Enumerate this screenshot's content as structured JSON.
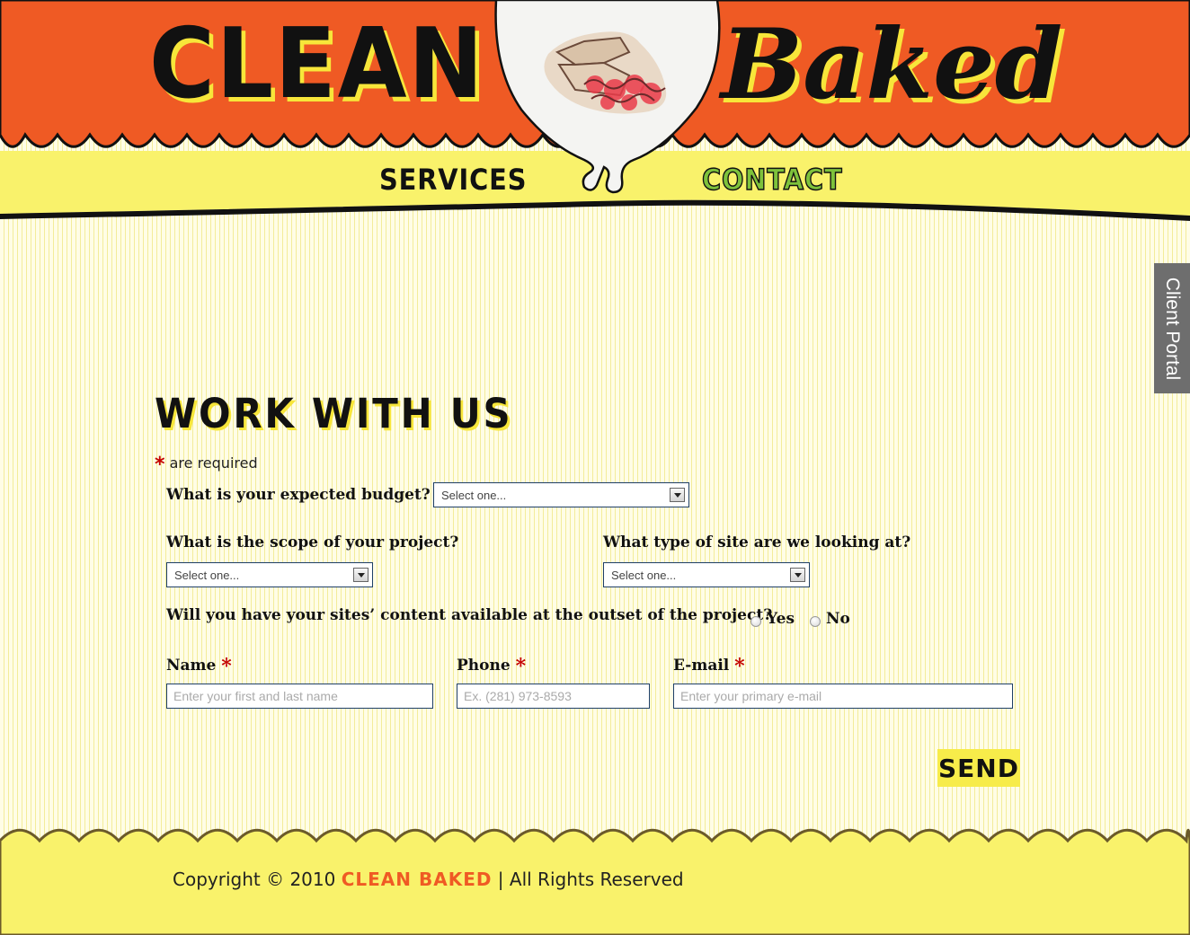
{
  "header": {
    "logo_left": "CLEAN",
    "logo_right": "Baked",
    "nav": {
      "services": "SERVICES",
      "contact": "CONTACT"
    },
    "colors": {
      "orange": "#ef5a24",
      "yellow": "#f9f26b",
      "contact_green": "#7ec23b"
    }
  },
  "client_portal": {
    "label": "Client Portal"
  },
  "form": {
    "title": "WORK WITH US",
    "required_star": "*",
    "required_note": "are required",
    "budget": {
      "label": "What is your expected budget?",
      "value": "Select one..."
    },
    "scope": {
      "label": "What is the scope of your project?",
      "value": "Select one..."
    },
    "site_type": {
      "label": "What type of site are we looking at?",
      "value": "Select one..."
    },
    "content": {
      "label": "Will you have your sites’ content available at the outset of the project?",
      "yes": "Yes",
      "no": "No"
    },
    "name": {
      "label": "Name",
      "placeholder": "Enter your first and last name"
    },
    "phone": {
      "label": "Phone",
      "placeholder": "Ex. (281) 973-8593"
    },
    "email": {
      "label": "E-mail",
      "placeholder": "Enter your primary e-mail"
    },
    "send": "SEND"
  },
  "footer": {
    "prefix": "Copyright © 2010 ",
    "brand": "CLEAN BAKED",
    "suffix": " | All Rights Reserved"
  }
}
